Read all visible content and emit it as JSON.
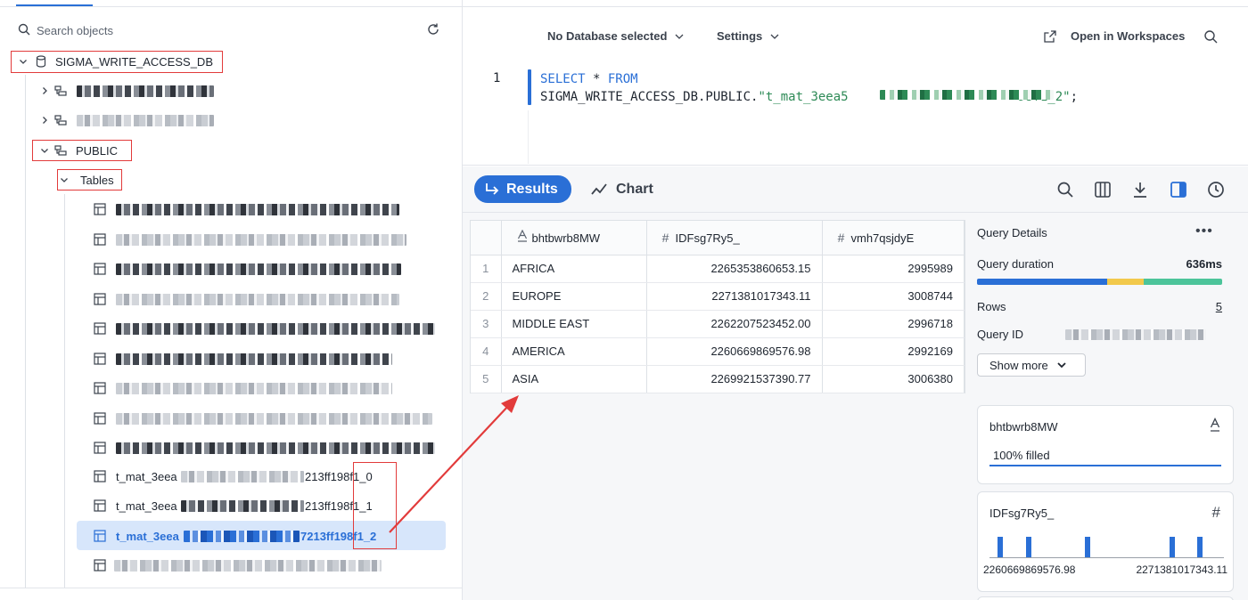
{
  "sidebar": {
    "search_placeholder": "Search objects",
    "database": "SIGMA_WRITE_ACCESS_DB",
    "schema_public": "PUBLIC",
    "tables_folder": "Tables",
    "tables": [
      {
        "prefix": "t_mat_3eea",
        "suffix": "213ff198f1_0"
      },
      {
        "prefix": "t_mat_3eea",
        "suffix": "213ff198f1_1"
      },
      {
        "prefix": "t_mat_3eea",
        "suffix": "7213ff198f1_2"
      }
    ]
  },
  "header": {
    "database_picker": "No Database selected",
    "settings": "Settings",
    "open_workspaces": "Open in Workspaces"
  },
  "editor": {
    "line_number": "1",
    "kw_select": "SELECT",
    "star": " * ",
    "kw_from": "FROM",
    "line2_prefix": "SIGMA_WRITE_ACCESS_DB.PUBLIC.",
    "line2_string_start": "\"t_mat_3eea5",
    "line2_string_end": "98f1_2\"",
    "line2_semicolon": ";"
  },
  "results_toolbar": {
    "results_label": "Results",
    "chart_label": "Chart"
  },
  "grid": {
    "columns": [
      {
        "name": "bhtbwrb8MW",
        "type_icon": "text-type-icon"
      },
      {
        "name": "IDFsg7Ry5_",
        "type_icon": "number-type-icon"
      },
      {
        "name": "vmh7qsjdyE",
        "type_icon": "number-type-icon"
      }
    ],
    "rows": [
      {
        "n": "1",
        "c1": "AFRICA",
        "c2": "2265353860653.15",
        "c3": "2995989"
      },
      {
        "n": "2",
        "c1": "EUROPE",
        "c2": "2271381017343.11",
        "c3": "3008744"
      },
      {
        "n": "3",
        "c1": "MIDDLE EAST",
        "c2": "2262207523452.00",
        "c3": "2996718"
      },
      {
        "n": "4",
        "c1": "AMERICA",
        "c2": "2260669869576.98",
        "c3": "2992169"
      },
      {
        "n": "5",
        "c1": "ASIA",
        "c2": "2269921537390.77",
        "c3": "3006380"
      }
    ]
  },
  "query_details": {
    "title": "Query Details",
    "duration_label": "Query duration",
    "duration_value": "636ms",
    "duration_segments": [
      {
        "fraction": 0.53,
        "color": "#2a6fd6"
      },
      {
        "fraction": 0.15,
        "color": "#f2c94c"
      },
      {
        "fraction": 0.32,
        "color": "#4cc49a"
      }
    ],
    "rows_label": "Rows",
    "rows_value": "5",
    "query_id_label": "Query ID",
    "show_more": "Show more",
    "card1": {
      "title": "bhtbwrb8MW",
      "fill": "100% filled"
    },
    "card2": {
      "title": "IDFsg7Ry5_",
      "min_label": "2260669869576.98",
      "max_label": "2271381017343.11",
      "histogram_values": [
        2260669869576.98,
        2262207523452.0,
        2265353860653.15,
        2269921537390.77,
        2271381017343.11
      ]
    }
  },
  "colors": {
    "accent": "#2a6fd6",
    "annotation": "#e23b3b"
  }
}
